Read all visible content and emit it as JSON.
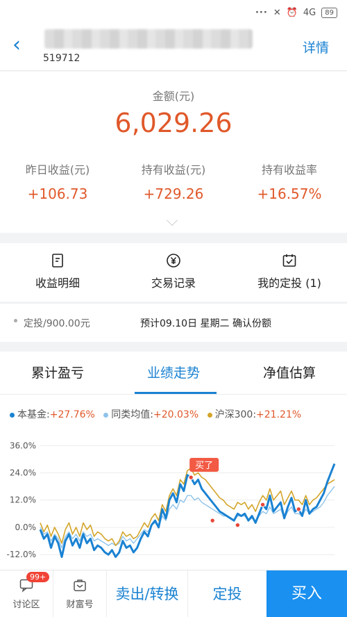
{
  "status_bar": {
    "network": "4G",
    "battery": "89"
  },
  "header": {
    "back_label": "‹",
    "fund_code": "519712",
    "detail_label": "详情"
  },
  "asset": {
    "amount_label": "金额(元)",
    "amount_value": "6,029.26",
    "stats": [
      {
        "label": "昨日收益(元)",
        "value": "+106.73"
      },
      {
        "label": "持有收益(元)",
        "value": "+729.26"
      },
      {
        "label": "持有收益率",
        "value": "+16.57%"
      }
    ]
  },
  "shortcuts": [
    {
      "label": "收益明细",
      "icon": "document-icon"
    },
    {
      "label": "交易记录",
      "icon": "yen-circle-icon"
    },
    {
      "label": "我的定投 (1)",
      "icon": "calendar-check-icon"
    }
  ],
  "plan": {
    "amount_text": "定投/900.00元",
    "schedule_text": "预计09.10日 星期二 确认份额"
  },
  "tabs": [
    {
      "label": "累计盈亏",
      "active": false
    },
    {
      "label": "业绩走势",
      "active": true
    },
    {
      "label": "净值估算",
      "active": false
    }
  ],
  "chart_legend": [
    {
      "name": "本基金:",
      "value": "+27.76%",
      "color": "#1a82d2"
    },
    {
      "name": "同类均值:",
      "value": "+20.03%",
      "color": "#8ec3ea"
    },
    {
      "name": "沪深300:",
      "value": "+21.21%",
      "color": "#d4a52a"
    }
  ],
  "chart_data": {
    "type": "line",
    "ylim": [
      -15,
      37
    ],
    "y_ticks": [
      "36.0%",
      "24.0%",
      "12.0%",
      "0.0%",
      "-12.0%"
    ],
    "y_tick_values": [
      36,
      24,
      12,
      0,
      -12
    ],
    "annotation": "买了",
    "series": [
      {
        "name": "本基金",
        "color": "#1a82d2",
        "values": [
          -1,
          -5,
          -3,
          -9,
          -4,
          -7,
          -13,
          -6,
          -3,
          -8,
          -5,
          -9,
          -3,
          -7,
          -5,
          -10,
          -8,
          -9,
          -11,
          -12,
          -10,
          -13,
          -11,
          -6,
          -9,
          -8,
          -11,
          -9,
          -5,
          -2,
          -4,
          1,
          3,
          0,
          8,
          4,
          12,
          15,
          11,
          19,
          16,
          23,
          22,
          19,
          21,
          17,
          15,
          13,
          11,
          9,
          7,
          6,
          5,
          4,
          3,
          6,
          5,
          6,
          3,
          5,
          2,
          6,
          10,
          8,
          14,
          7,
          9,
          11,
          4,
          9,
          13,
          7,
          8,
          5,
          12,
          6,
          8,
          9,
          12,
          15,
          20,
          24,
          28
        ]
      },
      {
        "name": "同类均值",
        "color": "#8ec3ea",
        "values": [
          0,
          -3,
          -2,
          -6,
          -3,
          -5,
          -9,
          -4,
          -2,
          -5,
          -3,
          -6,
          -2,
          -4,
          -3,
          -6,
          -5,
          -6,
          -7,
          -8,
          -7,
          -8,
          -7,
          -4,
          -6,
          -5,
          -7,
          -5,
          -3,
          -1,
          -2,
          1,
          2,
          0,
          5,
          3,
          8,
          10,
          8,
          12,
          11,
          14,
          14,
          12,
          13,
          11,
          10,
          9,
          8,
          7,
          6,
          5,
          5,
          4,
          3,
          5,
          5,
          5,
          3,
          4,
          3,
          5,
          7,
          6,
          9,
          6,
          7,
          8,
          4,
          7,
          9,
          6,
          6,
          5,
          8,
          6,
          7,
          8,
          9,
          11,
          14,
          16,
          18
        ]
      },
      {
        "name": "沪深300",
        "color": "#d4a52a",
        "values": [
          2,
          -2,
          1,
          -4,
          0,
          -3,
          -7,
          -1,
          2,
          -3,
          0,
          -4,
          2,
          -1,
          1,
          -4,
          -2,
          -3,
          -5,
          -6,
          -5,
          -8,
          -6,
          -2,
          -4,
          -3,
          -5,
          -4,
          -1,
          2,
          0,
          4,
          6,
          3,
          10,
          7,
          14,
          17,
          14,
          21,
          19,
          25,
          26,
          23,
          24,
          22,
          21,
          19,
          17,
          15,
          13,
          12,
          10,
          9,
          8,
          11,
          10,
          11,
          8,
          10,
          7,
          11,
          14,
          12,
          17,
          12,
          14,
          16,
          10,
          13,
          16,
          12,
          12,
          10,
          14,
          10,
          12,
          13,
          15,
          17,
          19,
          20,
          21
        ]
      }
    ],
    "markers": [
      {
        "x": 42,
        "y": 22
      },
      {
        "x": 48,
        "y": 3
      },
      {
        "x": 55,
        "y": 1
      },
      {
        "x": 62,
        "y": 10
      },
      {
        "x": 72,
        "y": 8
      }
    ]
  },
  "bottom_bar": {
    "forum_label": "讨论区",
    "forum_badge": "99+",
    "wealth_label": "财富号",
    "sell_label": "卖出/转换",
    "plan_label": "定投",
    "buy_label": "买入"
  }
}
